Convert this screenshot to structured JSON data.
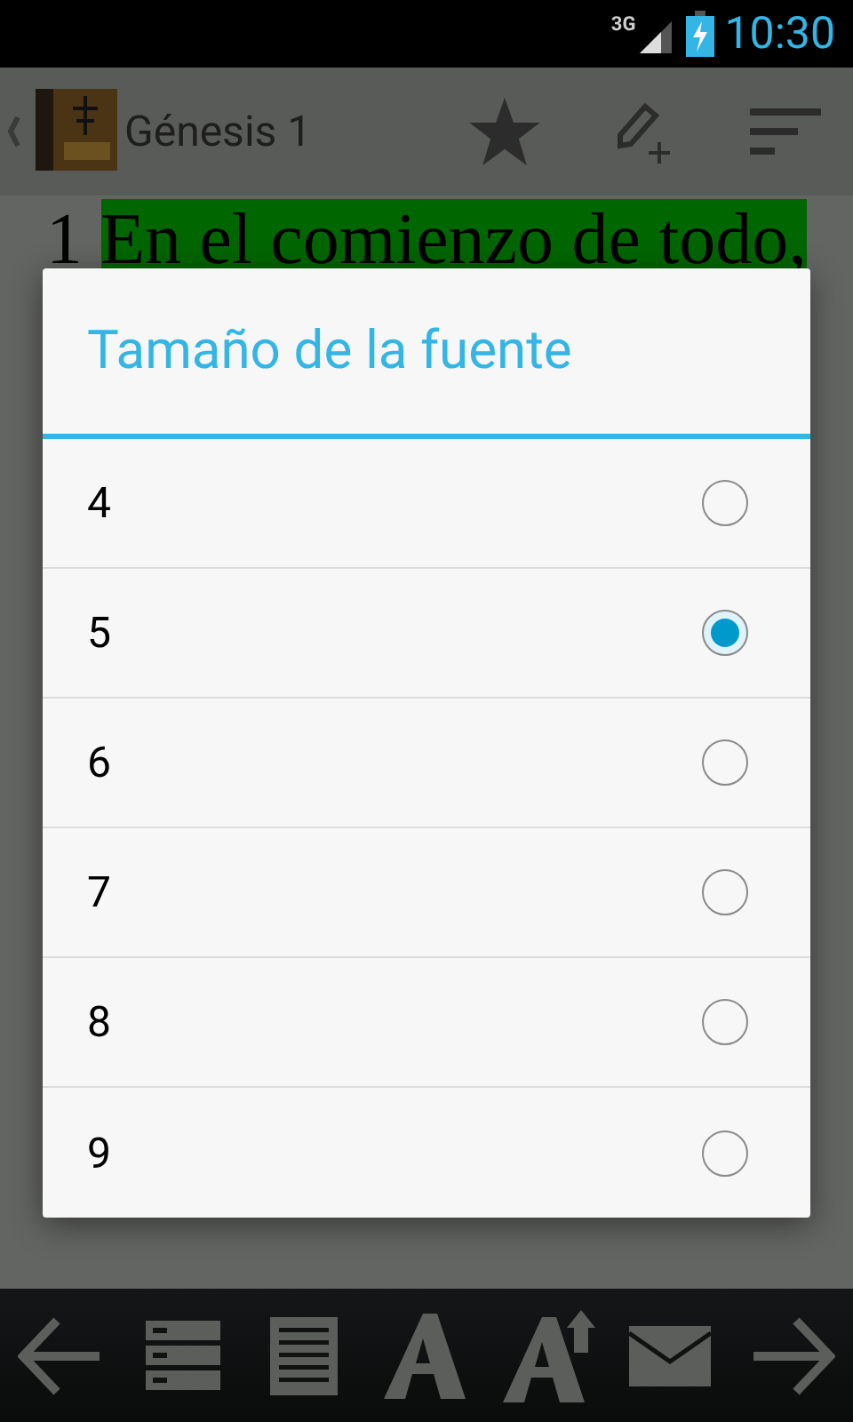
{
  "status_bar": {
    "network": "3G",
    "time": "10:30"
  },
  "action_bar": {
    "title": "Génesis 1"
  },
  "verse": {
    "number": "1",
    "text": "En el comienzo de todo,",
    "highlighted": true
  },
  "dialog": {
    "title": "Tamaño de la fuente",
    "options": [
      {
        "label": "4",
        "selected": false
      },
      {
        "label": "5",
        "selected": true
      },
      {
        "label": "6",
        "selected": false
      },
      {
        "label": "7",
        "selected": false
      },
      {
        "label": "8",
        "selected": false
      },
      {
        "label": "9",
        "selected": false
      }
    ]
  }
}
